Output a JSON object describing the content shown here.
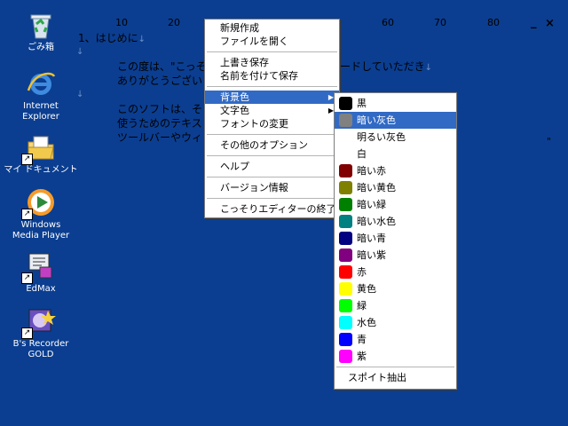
{
  "desktop": {
    "icons": [
      {
        "name": "recycle-bin",
        "label1": "ごみ箱",
        "label2": ""
      },
      {
        "name": "internet-explorer",
        "label1": "Internet",
        "label2": "Explorer"
      },
      {
        "name": "my-documents",
        "label1": "マイ ドキュメント",
        "label2": ""
      },
      {
        "name": "windows-media-player",
        "label1": "Windows",
        "label2": "Media Player"
      },
      {
        "name": "edmax",
        "label1": "EdMax",
        "label2": ""
      },
      {
        "name": "bs-recorder-gold",
        "label1": "B's Recorder",
        "label2": "GOLD"
      }
    ]
  },
  "editor": {
    "ruler": [
      "10",
      "20",
      "60",
      "70",
      "80"
    ],
    "window_controls": {
      "minimize": "_",
      "close": "×"
    },
    "lines": [
      "1、はじめに",
      "この度は、\"こっそ",
      "ありがとうござい",
      "このソフトは、そ",
      "使うためのテキス",
      "ツールバーやウィ"
    ],
    "line_tail": "ードしていただき",
    "return_mark": "↓",
    "quote_mark": "\""
  },
  "context_menu": {
    "items": [
      {
        "label": "新規作成"
      },
      {
        "label": "ファイルを開く"
      },
      {
        "label": "上書き保存"
      },
      {
        "label": "名前を付けて保存"
      },
      {
        "label": "背景色"
      },
      {
        "label": "文字色"
      },
      {
        "label": "フォントの変更"
      },
      {
        "label": "その他のオプション"
      },
      {
        "label": "ヘルプ"
      },
      {
        "label": "バージョン情報"
      },
      {
        "label": "こっそりエディターの終了"
      }
    ],
    "submenu_arrow": "▶"
  },
  "color_submenu": {
    "items": [
      {
        "label": "黒",
        "color": "#000000"
      },
      {
        "label": "暗い灰色",
        "color": "#808080"
      },
      {
        "label": "明るい灰色",
        "color": ""
      },
      {
        "label": "白",
        "color": ""
      },
      {
        "label": "暗い赤",
        "color": "#800000"
      },
      {
        "label": "暗い黄色",
        "color": "#808000"
      },
      {
        "label": "暗い緑",
        "color": "#008000"
      },
      {
        "label": "暗い水色",
        "color": "#008080"
      },
      {
        "label": "暗い青",
        "color": "#000080"
      },
      {
        "label": "暗い紫",
        "color": "#800080"
      },
      {
        "label": "赤",
        "color": "#ff0000"
      },
      {
        "label": "黄色",
        "color": "#ffff00"
      },
      {
        "label": "緑",
        "color": "#00ff00"
      },
      {
        "label": "水色",
        "color": "#00ffff"
      },
      {
        "label": "青",
        "color": "#0000ff"
      },
      {
        "label": "紫",
        "color": "#ff00ff"
      }
    ],
    "eyedropper": "スポイト抽出"
  },
  "colors": {
    "desktop_bg": "#0b3e90",
    "selection": "#316ac5"
  }
}
